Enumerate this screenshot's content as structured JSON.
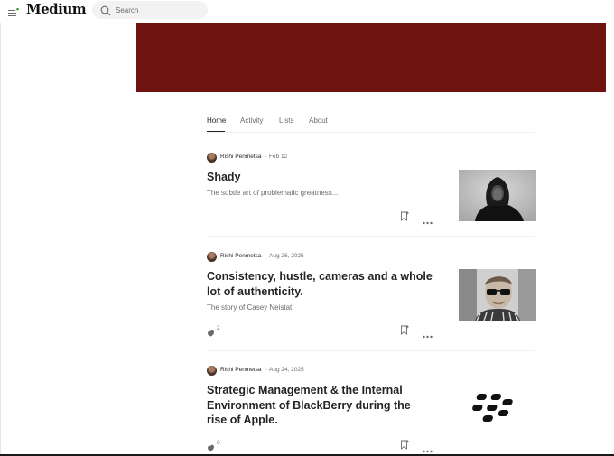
{
  "header": {
    "logo": "Medium",
    "search_placeholder": "Search",
    "menu_icon": "menu-icon",
    "search_icon": "search-icon",
    "notification_dot_color": "#1a8917"
  },
  "banner": {
    "color": "#6f1310"
  },
  "tabs": [
    {
      "label": "Home",
      "active": true
    },
    {
      "label": "Activity",
      "active": false
    },
    {
      "label": "Lists",
      "active": false
    },
    {
      "label": "About",
      "active": false
    }
  ],
  "posts": [
    {
      "author": "Rishi Penmetsa",
      "date": "Feb 12",
      "title": "Shady",
      "subtitle": "The subtle art of problematic greatness...",
      "claps": "",
      "thumbnail": "person-in-hoodie-photo"
    },
    {
      "author": "Rishi Penmetsa",
      "date": "Aug 26, 2025",
      "title": "Consistency, hustle, cameras and a whole lot of authenticity.",
      "subtitle": "The story of Casey Neistat",
      "claps": "2",
      "thumbnail": "man-with-sunglasses-photo"
    },
    {
      "author": "Rishi Penmetsa",
      "date": "Aug 24, 2025",
      "title": "Strategic Management & the Internal Environment of BlackBerry during the rise of Apple.",
      "subtitle": "",
      "claps": "6",
      "thumbnail": "blackberry-logo"
    }
  ]
}
